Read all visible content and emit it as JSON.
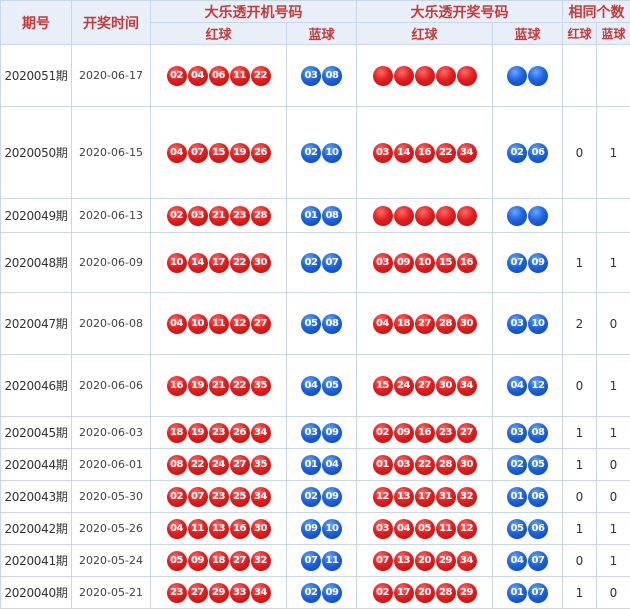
{
  "header": {
    "period": "期号",
    "draw_time": "开奖时间",
    "machine_group": "大乐透开机号码",
    "result_group": "大乐透开奖号码",
    "same_group": "相同个数",
    "red": "红球",
    "blue": "蓝球"
  },
  "colors": {
    "red_ball": "#e31f1f",
    "blue_ball": "#1e64e0",
    "header_text": "#c83a3a",
    "header_bg": "#e8eff8",
    "grid": "#c9d7e8"
  },
  "rows": [
    {
      "period": "2020051期",
      "date": "2020-06-17",
      "m_red": [
        "02",
        "04",
        "06",
        "11",
        "22"
      ],
      "m_blue": [
        "03",
        "08"
      ],
      "r_red": [
        "",
        "",
        "",
        "",
        ""
      ],
      "r_blue": [
        "",
        ""
      ],
      "same_red": "",
      "same_blue": ""
    },
    {
      "period": "2020050期",
      "date": "2020-06-15",
      "m_red": [
        "04",
        "07",
        "15",
        "19",
        "26"
      ],
      "m_blue": [
        "02",
        "10"
      ],
      "r_red": [
        "03",
        "14",
        "16",
        "22",
        "34"
      ],
      "r_blue": [
        "02",
        "06"
      ],
      "same_red": "0",
      "same_blue": "1"
    },
    {
      "period": "2020049期",
      "date": "2020-06-13",
      "m_red": [
        "02",
        "03",
        "21",
        "23",
        "28"
      ],
      "m_blue": [
        "01",
        "08"
      ],
      "r_red": [
        "",
        "",
        "",
        "",
        ""
      ],
      "r_blue": [
        "",
        ""
      ],
      "same_red": "",
      "same_blue": ""
    },
    {
      "period": "2020048期",
      "date": "2020-06-09",
      "m_red": [
        "10",
        "14",
        "17",
        "22",
        "30"
      ],
      "m_blue": [
        "02",
        "07"
      ],
      "r_red": [
        "03",
        "09",
        "10",
        "15",
        "16"
      ],
      "r_blue": [
        "07",
        "09"
      ],
      "same_red": "1",
      "same_blue": "1"
    },
    {
      "period": "2020047期",
      "date": "2020-06-08",
      "m_red": [
        "04",
        "10",
        "11",
        "12",
        "27"
      ],
      "m_blue": [
        "05",
        "08"
      ],
      "r_red": [
        "04",
        "18",
        "27",
        "28",
        "30"
      ],
      "r_blue": [
        "03",
        "10"
      ],
      "same_red": "2",
      "same_blue": "0"
    },
    {
      "period": "2020046期",
      "date": "2020-06-06",
      "m_red": [
        "16",
        "19",
        "21",
        "22",
        "35"
      ],
      "m_blue": [
        "04",
        "05"
      ],
      "r_red": [
        "15",
        "24",
        "27",
        "30",
        "34"
      ],
      "r_blue": [
        "04",
        "12"
      ],
      "same_red": "0",
      "same_blue": "1"
    },
    {
      "period": "2020045期",
      "date": "2020-06-03",
      "m_red": [
        "18",
        "19",
        "23",
        "26",
        "34"
      ],
      "m_blue": [
        "03",
        "09"
      ],
      "r_red": [
        "02",
        "09",
        "16",
        "23",
        "27"
      ],
      "r_blue": [
        "03",
        "08"
      ],
      "same_red": "1",
      "same_blue": "1"
    },
    {
      "period": "2020044期",
      "date": "2020-06-01",
      "m_red": [
        "08",
        "22",
        "24",
        "27",
        "35"
      ],
      "m_blue": [
        "01",
        "04"
      ],
      "r_red": [
        "01",
        "03",
        "22",
        "28",
        "30"
      ],
      "r_blue": [
        "02",
        "05"
      ],
      "same_red": "1",
      "same_blue": "0"
    },
    {
      "period": "2020043期",
      "date": "2020-05-30",
      "m_red": [
        "02",
        "07",
        "23",
        "25",
        "34"
      ],
      "m_blue": [
        "02",
        "09"
      ],
      "r_red": [
        "12",
        "13",
        "17",
        "31",
        "32"
      ],
      "r_blue": [
        "01",
        "06"
      ],
      "same_red": "0",
      "same_blue": "0"
    },
    {
      "period": "2020042期",
      "date": "2020-05-26",
      "m_red": [
        "04",
        "11",
        "13",
        "16",
        "30"
      ],
      "m_blue": [
        "09",
        "10"
      ],
      "r_red": [
        "03",
        "04",
        "05",
        "11",
        "12"
      ],
      "r_blue": [
        "05",
        "06"
      ],
      "same_red": "1",
      "same_blue": "1"
    },
    {
      "period": "2020041期",
      "date": "2020-05-24",
      "m_red": [
        "05",
        "09",
        "18",
        "27",
        "32"
      ],
      "m_blue": [
        "07",
        "11"
      ],
      "r_red": [
        "07",
        "13",
        "20",
        "29",
        "34"
      ],
      "r_blue": [
        "04",
        "07"
      ],
      "same_red": "0",
      "same_blue": "1"
    },
    {
      "period": "2020040期",
      "date": "2020-05-21",
      "m_red": [
        "23",
        "27",
        "29",
        "33",
        "34"
      ],
      "m_blue": [
        "02",
        "09"
      ],
      "r_red": [
        "02",
        "17",
        "20",
        "28",
        "29"
      ],
      "r_blue": [
        "01",
        "07"
      ],
      "same_red": "1",
      "same_blue": "0"
    }
  ]
}
